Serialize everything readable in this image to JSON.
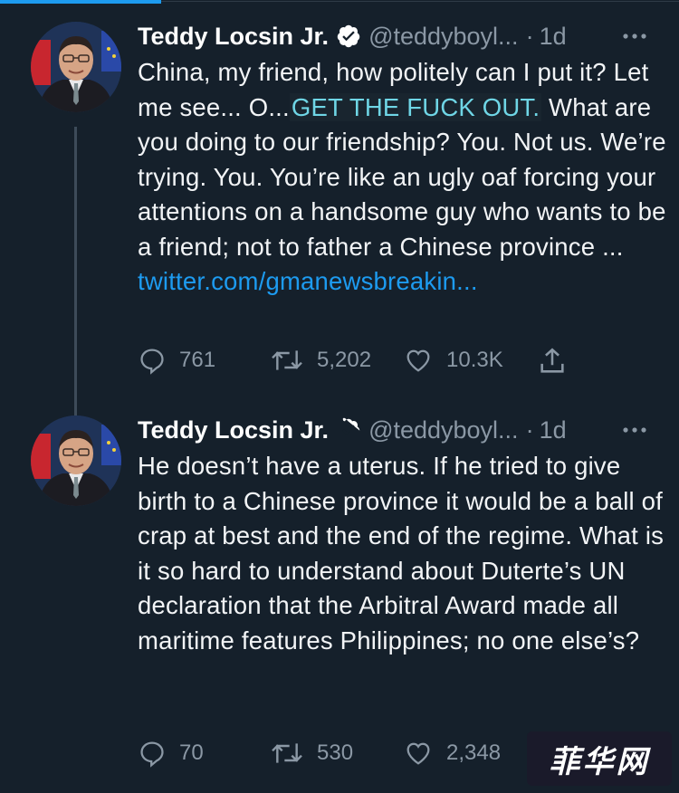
{
  "tweets": [
    {
      "author": "Teddy Locsin Jr.",
      "handle": "@teddyboyl...",
      "separator": "·",
      "time": "1d",
      "text_parts": {
        "before": "China, my friend, how politely can I put it? Let me see... O...",
        "highlight": "GET THE FUCK OUT.",
        "after": " What are you doing to our friendship? You. Not us. We’re trying. You. You’re like an ugly oaf forcing your attentions on a handsome guy who wants to be a friend; not to father a Chinese province ...",
        "link": "twitter.com/gmanewsbreakin..."
      },
      "stats": {
        "replies": "761",
        "retweets": "5,202",
        "likes": "10.3K"
      }
    },
    {
      "author": "Teddy Locsin Jr.",
      "handle": "@teddyboyl...",
      "separator": "·",
      "time": "1d",
      "text": "He doesn’t have a uterus. If he tried to give birth to a Chinese province it would be a ball of crap at best and the end of the regime. What is it so hard to understand about Duterte’s UN declaration that the Arbitral Award made all maritime features Philippines; no one else’s?",
      "stats": {
        "replies": "70",
        "retweets": "530",
        "likes": "2,348"
      }
    }
  ],
  "watermark": "菲华网",
  "colors": {
    "background": "#15202b",
    "accent": "#1d9bf0",
    "muted": "#8b98a5",
    "highlight_text": "#6fd6e6"
  }
}
